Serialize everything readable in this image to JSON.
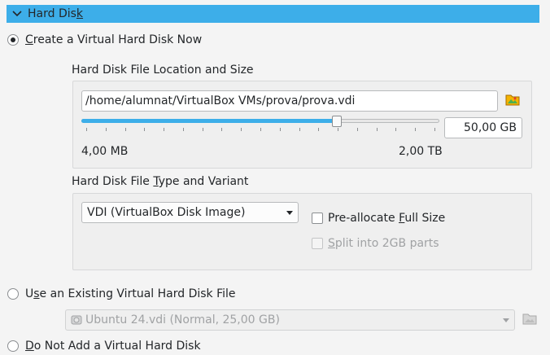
{
  "section": {
    "title_pre": "Hard Dis",
    "title_mn": "k",
    "accent": "#3daee9"
  },
  "create_option": {
    "mn": "C",
    "label_rest": "reate a Virtual Hard Disk Now",
    "checked": true
  },
  "location_group": {
    "title": "Hard Disk File Location and Size",
    "path_value": "/home/alumnat/VirtualBox VMs/prova/prova.vdi",
    "folder_icon": "folder-icon",
    "size_value": "50,00 GB",
    "min_label": "4,00 MB",
    "max_label": "2,00 TB",
    "slider_fraction": 0.72
  },
  "type_group": {
    "title_pre": "Hard Disk File ",
    "title_mn": "T",
    "title_rest": "ype and Variant",
    "format_selected": "VDI (VirtualBox Disk Image)",
    "preallocate_pre": "Pre-allocate ",
    "preallocate_mn": "F",
    "preallocate_rest": "ull Size",
    "split_mn": "S",
    "split_rest": "plit into 2GB parts"
  },
  "existing_option": {
    "pre": "U",
    "mn": "s",
    "rest": "e an Existing Virtual Hard Disk File",
    "checked": false,
    "disk_selected": "Ubuntu 24.vdi (Normal, 25,00 GB)",
    "disk_icon": "hard-disk-icon",
    "folder_icon": "folder-icon"
  },
  "none_option": {
    "mn": "D",
    "rest": "o Not Add a Virtual Hard Disk",
    "checked": false
  }
}
